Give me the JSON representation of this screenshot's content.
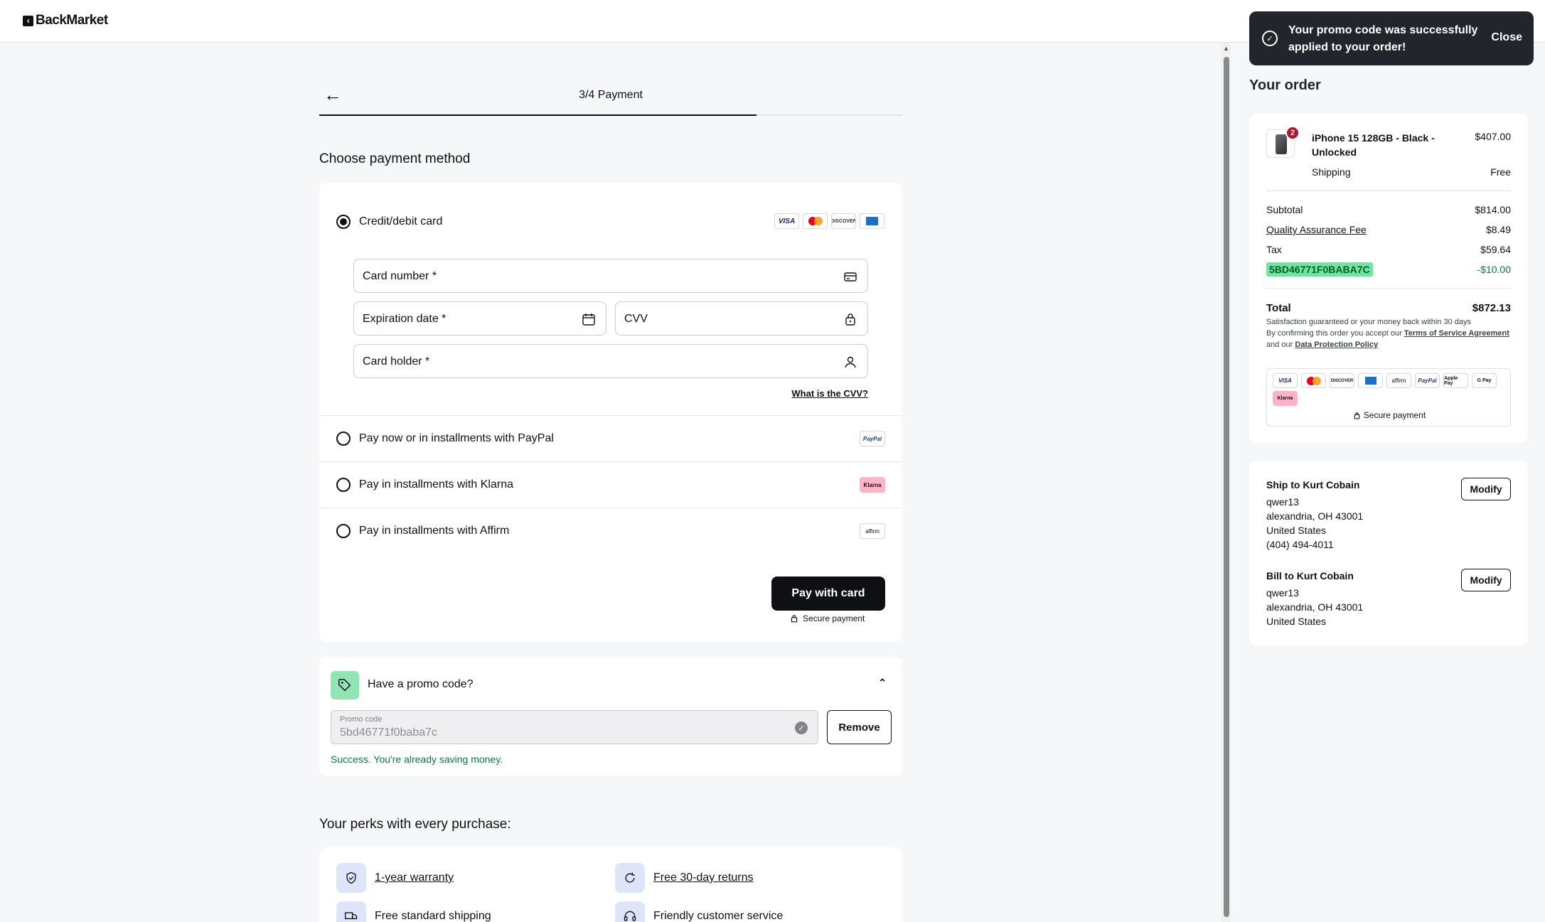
{
  "brand": {
    "logo_text": "BackMarket"
  },
  "stepper": {
    "label": "3/4 Payment",
    "progress": 0.75
  },
  "payment": {
    "section_title": "Choose payment method",
    "methods": [
      {
        "label": "Credit/debit card",
        "selected": true
      },
      {
        "label": "Pay now or in installments with PayPal",
        "selected": false,
        "logo": "PayPal"
      },
      {
        "label": "Pay in installments with Klarna",
        "selected": false,
        "logo": "Klarna"
      },
      {
        "label": "Pay in installments with Affirm",
        "selected": false,
        "logo": "affirm"
      }
    ],
    "card_logos": [
      "VISA",
      "Mastercard",
      "DISCOVER",
      "AMEX"
    ],
    "fields": {
      "card_number": "Card number *",
      "expiration": "Expiration date *",
      "cvv": "CVV",
      "holder": "Card holder *"
    },
    "cvv_help": "What is the CVV?",
    "pay_button": "Pay with card",
    "secure_label": "Secure payment"
  },
  "promo": {
    "title": "Have a promo code?",
    "input_label": "Promo code",
    "input_value": "5bd46771f0baba7c",
    "remove_button": "Remove",
    "success": "Success. You're already saving money."
  },
  "perks": {
    "title": "Your perks with every purchase:",
    "items": [
      "1-year warranty",
      "Free 30-day returns",
      "Free standard shipping",
      "Friendly customer service"
    ]
  },
  "toast": {
    "message": "Your promo code was successfully applied to your order!",
    "close": "Close"
  },
  "order": {
    "title": "Your order",
    "item_name": "iPhone 15 128GB - Black - Unlocked",
    "item_price": "$407.00",
    "quantity": "2",
    "shipping_label": "Shipping",
    "shipping_value": "Free",
    "subtotal_label": "Subtotal",
    "subtotal_value": "$814.00",
    "fee_label": "Quality Assurance Fee",
    "fee_value": "$8.49",
    "tax_label": "Tax",
    "tax_value": "$59.64",
    "promo_code": "5BD46771F0BABA7C",
    "promo_value": "-$10.00",
    "total_label": "Total",
    "total_value": "$872.13",
    "guarantee": "Satisfaction guaranteed or your money back within 30 days",
    "terms_prefix": "By confirming this order you accept our",
    "terms_link": "Terms of Service Agreement",
    "terms_mid": "and our",
    "privacy_link": "Data Protection Policy",
    "pay_logos": [
      "VISA",
      "MC",
      "DISCOVER",
      "AMEX",
      "affirm",
      "PayPal",
      "Apple Pay",
      "G Pay",
      "Klarna"
    ],
    "secure_label": "Secure payment"
  },
  "shipping": {
    "ship_title": "Ship to Kurt Cobain",
    "ship_lines": [
      "qwer13",
      "alexandria, OH 43001",
      "United States",
      "(404) 494-4011"
    ],
    "bill_title": "Bill to Kurt Cobain",
    "bill_lines": [
      "qwer13",
      "alexandria, OH 43001",
      "United States"
    ],
    "modify_label": "Modify"
  },
  "colors": {
    "accent": "#0e1014",
    "promo_green": "#6ee6a0",
    "success_text": "#0a7a3d",
    "badge_red": "#b3112d"
  }
}
